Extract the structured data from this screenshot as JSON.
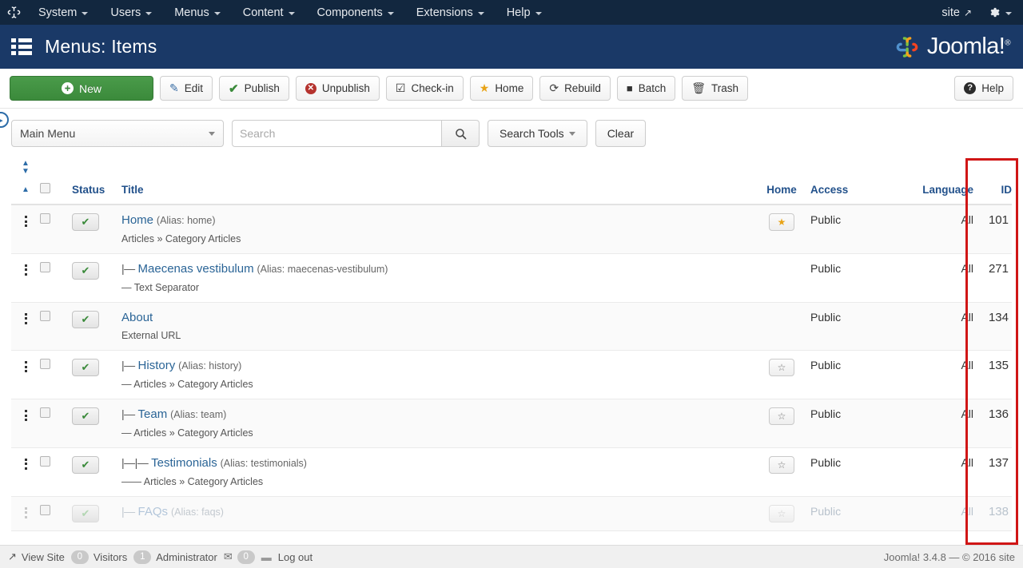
{
  "topbar": {
    "brand_icon": "joomla-logo-icon",
    "menu": [
      {
        "label": "System"
      },
      {
        "label": "Users"
      },
      {
        "label": "Menus"
      },
      {
        "label": "Content"
      },
      {
        "label": "Components"
      },
      {
        "label": "Extensions"
      },
      {
        "label": "Help"
      }
    ],
    "site_label": "site",
    "site_icon": "external-link-icon",
    "gear_icon": "gear-icon"
  },
  "subheader": {
    "title": "Menus: Items",
    "icon": "list-icon",
    "logo_text": "Joomla!",
    "logo_sup": "®"
  },
  "toolbar": {
    "new": "New",
    "edit": "Edit",
    "publish": "Publish",
    "unpublish": "Unpublish",
    "checkin": "Check-in",
    "home": "Home",
    "rebuild": "Rebuild",
    "batch": "Batch",
    "trash": "Trash",
    "help": "Help"
  },
  "filters": {
    "menu_select": "Main Menu",
    "search_placeholder": "Search",
    "search_value": "",
    "search_tools": "Search Tools",
    "clear": "Clear"
  },
  "table": {
    "headers": {
      "status": "Status",
      "title": "Title",
      "home": "Home",
      "access": "Access",
      "language": "Language",
      "id": "ID"
    },
    "rows": [
      {
        "prefix": "",
        "title": "Home",
        "alias": "(Alias: home)",
        "sub": "Articles » Category Articles",
        "home": "on",
        "access": "Public",
        "language": "All",
        "id": "101",
        "faded": false
      },
      {
        "prefix": "|—",
        "title": "Maecenas vestibulum",
        "alias": "(Alias: maecenas-vestibulum)",
        "sub": "— Text Separator",
        "home": "none",
        "access": "Public",
        "language": "All",
        "id": "271",
        "faded": false
      },
      {
        "prefix": "",
        "title": "About",
        "alias": "",
        "sub": "External URL",
        "home": "none",
        "access": "Public",
        "language": "All",
        "id": "134",
        "faded": false
      },
      {
        "prefix": "|—",
        "title": "History",
        "alias": "(Alias: history)",
        "sub": "— Articles » Category Articles",
        "home": "off",
        "access": "Public",
        "language": "All",
        "id": "135",
        "faded": false
      },
      {
        "prefix": "|—",
        "title": "Team",
        "alias": "(Alias: team)",
        "sub": "— Articles » Category Articles",
        "home": "off",
        "access": "Public",
        "language": "All",
        "id": "136",
        "faded": false
      },
      {
        "prefix": "|—|—",
        "title": "Testimonials",
        "alias": "(Alias: testimonials)",
        "sub": "—— Articles » Category Articles",
        "home": "off",
        "access": "Public",
        "language": "All",
        "id": "137",
        "faded": false
      },
      {
        "prefix": "|—",
        "title": "FAQs",
        "alias": "(Alias: faqs)",
        "sub": "",
        "home": "off",
        "access": "Public",
        "language": "All",
        "id": "138",
        "faded": true
      }
    ]
  },
  "footer": {
    "view_site": "View Site",
    "visitors_count": "0",
    "visitors_label": "Visitors",
    "admin_count": "1",
    "admin_label": "Administrator",
    "messages_count": "0",
    "logout": "Log out",
    "copyright": "Joomla! 3.4.8  —  © 2016 site"
  },
  "annotation": {
    "highlight_color": "#d01616",
    "target_column": "ID"
  }
}
